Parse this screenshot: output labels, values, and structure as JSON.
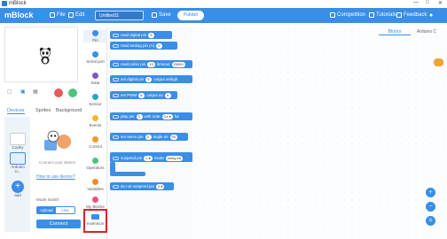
{
  "window": {
    "title": "mBlock",
    "controls": [
      "—",
      "□",
      "✕"
    ]
  },
  "menubar": {
    "logo": "mBlock",
    "file": "File",
    "edit": "Edit",
    "project_name": "Untitled11",
    "save": "Save",
    "publish": "Publish",
    "competition": "Competition",
    "tutorials": "Tutorials",
    "feedback": "Feedback"
  },
  "devices_panel": {
    "tabs": [
      "Devices",
      "Sprites",
      "Background"
    ],
    "devices": [
      {
        "label": "Codey"
      },
      {
        "label": "Arduino U..."
      }
    ],
    "add_label": "add",
    "connect_text": "Connect your device",
    "how_link": "How to use device?",
    "mode_label": "Mode Switch",
    "mode_options": [
      "Upload",
      "Live"
    ],
    "connect_button": "Connect"
  },
  "categories": [
    {
      "label": "Pin",
      "color": "#3a8ee6"
    },
    {
      "label": "Serial port",
      "color": "#3a8ee6"
    },
    {
      "label": "Data",
      "color": "#7c55c9"
    },
    {
      "label": "Sensor",
      "color": "#2aa5c9"
    },
    {
      "label": "Events",
      "color": "#f2b731"
    },
    {
      "label": "Control",
      "color": "#f29a2e"
    },
    {
      "label": "Operators",
      "color": "#4ec37e"
    },
    {
      "label": "Variables",
      "color": "#f08b2b"
    },
    {
      "label": "My Blocks",
      "color": "#e8547c"
    },
    {
      "label": "extension"
    }
  ],
  "blocks": [
    {
      "text": "read digital pin",
      "slot": "9"
    },
    {
      "text": "read analog pin (A)",
      "slot": "0"
    },
    {
      "text": "read pulse pin",
      "slot": "13",
      "text2": "timeout",
      "slot2": "20000"
    },
    {
      "text": "set digital pin",
      "slot": "9",
      "text2": "output as",
      "text3": "high"
    },
    {
      "text": "set PWM",
      "slot": "5",
      "text2": "output as",
      "slot2": "0"
    },
    {
      "text": "play pin",
      "slot": "3",
      "text2": "with note",
      "slot2": "C4 ▾",
      "text3": "for"
    },
    {
      "text": "set servo pin",
      "slot": "4",
      "text2": "angle as",
      "slot2": "90"
    },
    {
      "text": "suspend pin",
      "slot": "2 ▾",
      "text2": "mode",
      "slot2": "rising ed"
    },
    {
      "text": "do not suspend pin",
      "slot": "2 ▾"
    }
  ],
  "code_tabs": {
    "blocks": "Blocks",
    "arduino": "Arduino C"
  }
}
